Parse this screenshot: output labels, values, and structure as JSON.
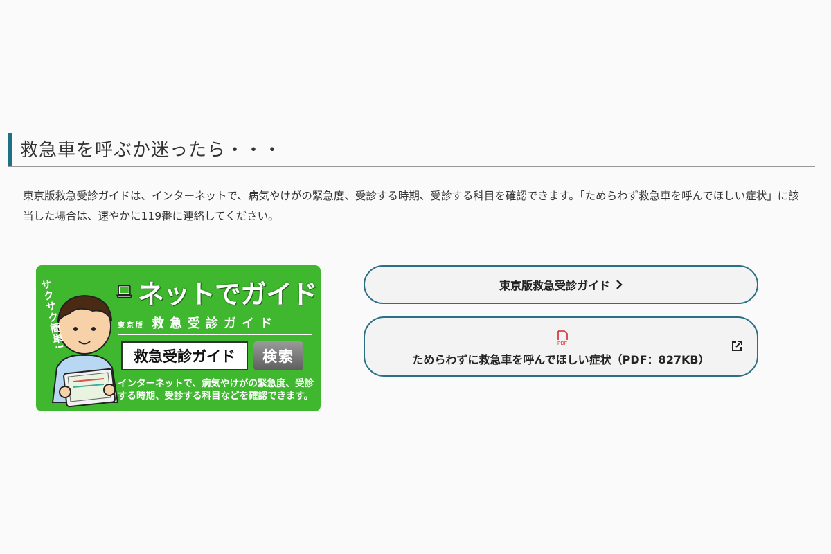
{
  "section": {
    "heading": "救急車を呼ぶか迷ったら・・・",
    "intro": "東京版救急受診ガイドは、インターネットで、病気やけがの緊急度、受診する時期、受診する科目を確認できます。「ためらわず救急車を呼んでほしい症状」に該当した場合は、速やかに119番に連絡してください。"
  },
  "banner": {
    "vertical_text": "サクサク簡単!",
    "title": "ネットでガイド",
    "sub_small": "東京版",
    "sub_main": "救急受診ガイド",
    "search_box_text": "救急受診ガイド",
    "search_button": "検索",
    "description": "インターネットで、病気やけがの緊急度、受診する時期、受診する科目などを確認できます。",
    "colors": {
      "background": "#3fb82f"
    },
    "icons": [
      "laptop-icon",
      "person-illustration"
    ]
  },
  "links": {
    "guide_label": "東京版救急受診ガイド",
    "pdf_label": "ためらわずに救急車を呼んでほしい症状（PDF：827KB）",
    "pdf_icon_text": "PDF",
    "accent": "#2b6f85",
    "icons": [
      "chevron-right-icon",
      "pdf-icon",
      "external-link-icon"
    ]
  }
}
